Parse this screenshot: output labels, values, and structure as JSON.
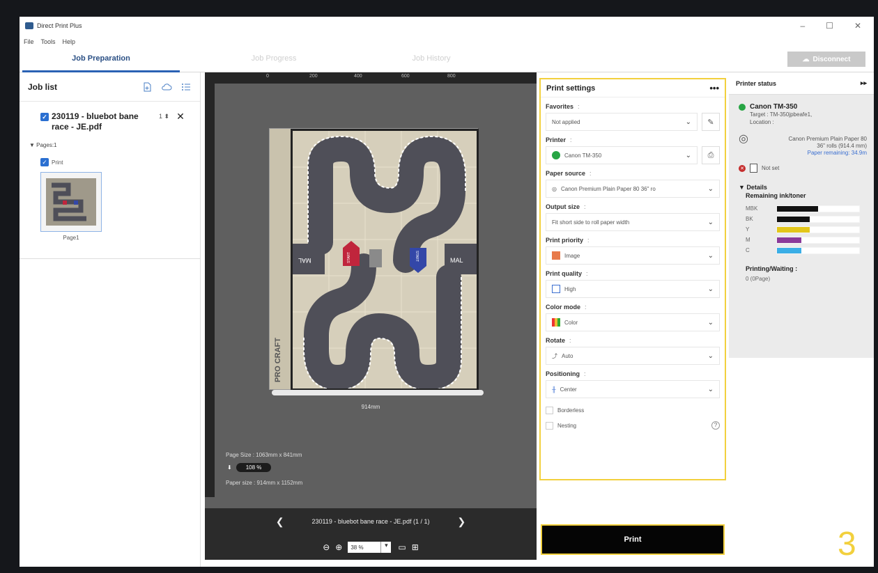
{
  "app": {
    "title": "Direct Print Plus",
    "window_controls": [
      "–",
      "☐",
      "✕"
    ]
  },
  "menu": [
    "File",
    "Tools",
    "Help"
  ],
  "tabs": [
    {
      "label": "Job Preparation",
      "active": true
    },
    {
      "label": "Job Progress",
      "active": false
    },
    {
      "label": "Job History",
      "active": false
    }
  ],
  "disconnect_label": "Disconnect",
  "joblist": {
    "title": "Job list",
    "job_name": "230119 - bluebot bane race - JE.pdf",
    "copies": "1",
    "pages_label": "Pages:1",
    "print_label": "Print",
    "page_label": "Page1"
  },
  "preview": {
    "ruler_ticks": [
      "0",
      "200",
      "400",
      "600",
      "800"
    ],
    "roll_width": "914mm",
    "page_size": "Page Size : 1063mm x 841mm",
    "scale": "108 %",
    "paper_size": "Paper size : 914mm x 1152mm",
    "file_nav": "230119 - bluebot bane race - JE.pdf (1 / 1)",
    "zoom": "38 %",
    "track_labels": {
      "left": "MAL",
      "right": "MAL",
      "start": "START",
      "brand": "PRO CRAFT"
    }
  },
  "settings": {
    "title": "Print settings",
    "more": "•••",
    "favorites": {
      "label": "Favorites",
      "value": "Not applied"
    },
    "printer": {
      "label": "Printer",
      "value": "Canon TM-350"
    },
    "paper_source": {
      "label": "Paper source",
      "value": "Canon Premium Plain Paper 80 36\" ro"
    },
    "output_size": {
      "label": "Output size",
      "value": "Fit short side to roll paper width"
    },
    "print_priority": {
      "label": "Print priority",
      "value": "Image"
    },
    "print_quality": {
      "label": "Print quality",
      "value": "High"
    },
    "color_mode": {
      "label": "Color mode",
      "value": "Color"
    },
    "rotate": {
      "label": "Rotate",
      "value": "Auto"
    },
    "positioning": {
      "label": "Positioning",
      "value": "Center"
    },
    "borderless": "Borderless",
    "nesting": "Nesting",
    "colon": ":"
  },
  "print_button": "Print",
  "step_number": "3",
  "status": {
    "title": "Printer status",
    "expand": "▸▸",
    "printer_name": "Canon TM-350",
    "target": "Target : TM-350jpbeafe1,",
    "location": "Location :",
    "media_name": "Canon Premium Plain Paper 80",
    "media_size": "36\" rolls (914.4 mm)",
    "paper_remaining": "Paper remaining: 34.9m",
    "tray_state": "Not set",
    "details": "Details",
    "ink_title": "Remaining ink/toner",
    "inks": [
      {
        "name": "MBK",
        "level": 0.5,
        "color": "#111111"
      },
      {
        "name": "BK",
        "level": 0.4,
        "color": "#111111"
      },
      {
        "name": "Y",
        "level": 0.4,
        "color": "#e3c61a"
      },
      {
        "name": "M",
        "level": 0.3,
        "color": "#8a3a9a"
      },
      {
        "name": "C",
        "level": 0.3,
        "color": "#3aaee6"
      }
    ],
    "printing_label": "Printing/Waiting :",
    "printing_value": "0 (0Page)"
  },
  "colors": {
    "accent": "#2a61b4",
    "highlight": "#f2d03d",
    "ok": "#27a544",
    "error": "#c52d2d"
  }
}
